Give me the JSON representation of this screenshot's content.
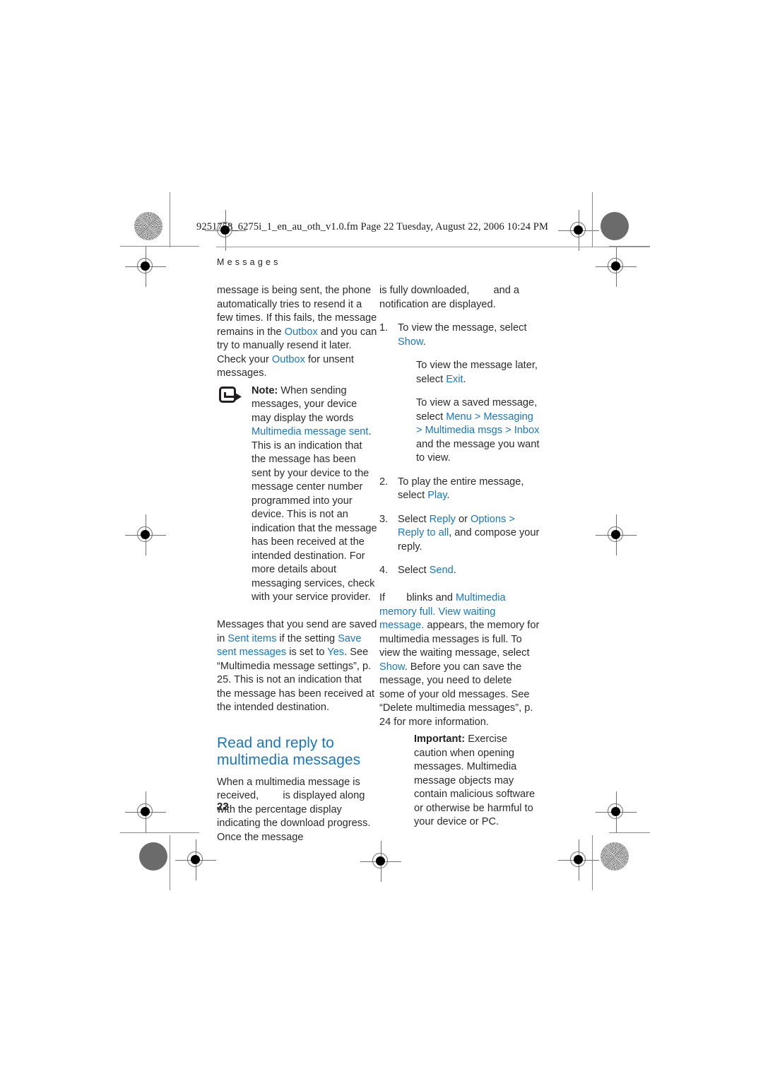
{
  "page": {
    "file_line": "9251758_6275i_1_en_au_oth_v1.0.fm  Page 22  Tuesday, August 22, 2006  10:24 PM",
    "chapter": "Messages",
    "page_number": "22",
    "accent_color": "#1977be",
    "text_color": "#2b2b2b"
  },
  "left_column": {
    "para1": {
      "t1": "message is being sent, the phone automatically tries to resend it a few times. If this fails, the message remains in the ",
      "hl1": "Outbox",
      "t2": " and you can try to manually resend it later. Check your ",
      "hl2": "Outbox",
      "t3": " for unsent messages."
    },
    "note": {
      "icon": "note-arrow-icon",
      "label": "Note:",
      "t1": " When sending messages, your device may display the words ",
      "hl1": "Multimedia message sent",
      "t2": ". This is an indication that the message has been sent by your device to the message center number programmed into your device. This is not an indication that the message has been received at the intended destination. For more details about messaging services, check with your service provider."
    },
    "para2": {
      "t1": "Messages that you send are saved in ",
      "hl1": "Sent items",
      "t2": " if the setting ",
      "hl2": "Save sent messages",
      "t3": " is set to ",
      "hl3": "Yes",
      "t4": ". See “Multimedia message settings”, p. 25. This is not an indication that the message has been received at the intended destination."
    },
    "section_title": "Read and reply to multimedia messages",
    "para3": {
      "t1": "When a multimedia message is received, ",
      "t2": " is displayed along with the percentage display indicating the download progress. Once the message"
    }
  },
  "right_column": {
    "para1": {
      "t1": "is fully downloaded, ",
      "t2": " and a notification are displayed."
    },
    "steps": [
      {
        "num": "1.",
        "t1": "To view the message, select ",
        "hl1": "Show",
        "t2": "."
      },
      {
        "num": "2.",
        "t1": "To play the entire message, select ",
        "hl1": "Play",
        "t2": "."
      },
      {
        "num": "3.",
        "t1": "Select ",
        "hl1": "Reply",
        "t2": " or ",
        "hl2": "Options",
        "t3": " > ",
        "hl3": "Reply to all",
        "t4": ", and compose your reply."
      },
      {
        "num": "4.",
        "t1": "Select ",
        "hl1": "Send",
        "t2": "."
      }
    ],
    "step1_sub_a": {
      "t1": "To view the message later, select ",
      "hl1": "Exit",
      "t2": "."
    },
    "step1_sub_b": {
      "t1": "To view a saved message, select ",
      "hl1": "Menu",
      "t2": " > ",
      "hl2": "Messaging",
      "t3": " > ",
      "hl3": "Multimedia msgs",
      "t4": " > ",
      "hl4": "Inbox",
      "t5": " and the message you want to view."
    },
    "para2": {
      "t1": "If ",
      "t2": " blinks and ",
      "hl1": "Multimedia memory full. View waiting message.",
      "t3": " appears, the memory for multimedia messages is full. To view the waiting message, select ",
      "hl2": "Show",
      "t4": ". Before you can save the message, you need to delete some of your old messages. See “Delete multimedia messages”, p. 24 for more information."
    },
    "important": {
      "label": "Important:",
      "t1": " Exercise caution when opening messages. Multimedia message objects may contain malicious software or otherwise be harmful to your device or PC."
    }
  }
}
